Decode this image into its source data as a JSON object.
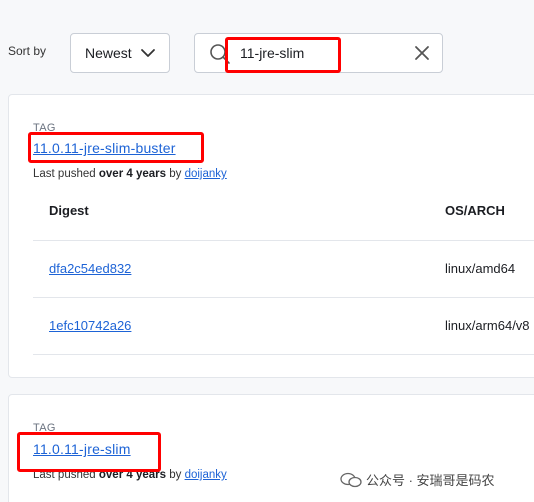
{
  "toolbar": {
    "sort_label": "Sort by",
    "sort_value": "Newest",
    "search_value": "11-jre-slim"
  },
  "tags": [
    {
      "label": "TAG",
      "name": "11.0.11-jre-slim-buster",
      "pushed_prefix": "Last pushed",
      "pushed_age": "over 4 years",
      "pushed_by": "by",
      "user": "doijanky",
      "table": {
        "headers": [
          "Digest",
          "OS/ARCH"
        ],
        "rows": [
          {
            "digest": "dfa2c54ed832",
            "arch": "linux/amd64"
          },
          {
            "digest": "1efc10742a26",
            "arch": "linux/arm64/v8"
          }
        ]
      }
    },
    {
      "label": "TAG",
      "name": "11.0.11-jre-slim",
      "pushed_prefix": "Last pushed",
      "pushed_age": "over 4 years",
      "pushed_by": "by",
      "user": "doijanky"
    }
  ],
  "watermark": {
    "text": "公众号 · 安瑞哥是码农"
  },
  "colors": {
    "link": "#1d63d6",
    "annotation": "#ff0000"
  }
}
